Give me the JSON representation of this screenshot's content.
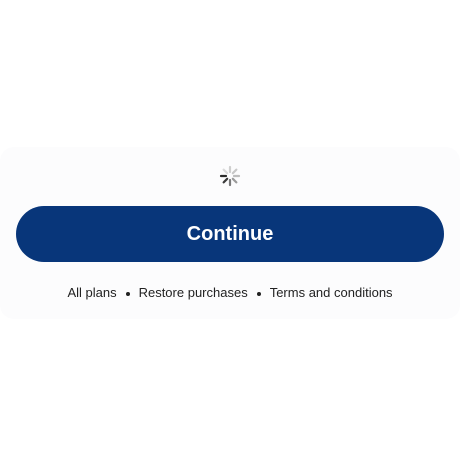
{
  "colors": {
    "primary": "#08367a",
    "panel": "#fcfcfd"
  },
  "loading_indicator": {
    "icon": "activity-spinner-icon"
  },
  "continue_button": {
    "label": "Continue"
  },
  "footer_links": [
    {
      "label": "All plans"
    },
    {
      "label": "Restore purchases"
    },
    {
      "label": "Terms and conditions"
    }
  ]
}
